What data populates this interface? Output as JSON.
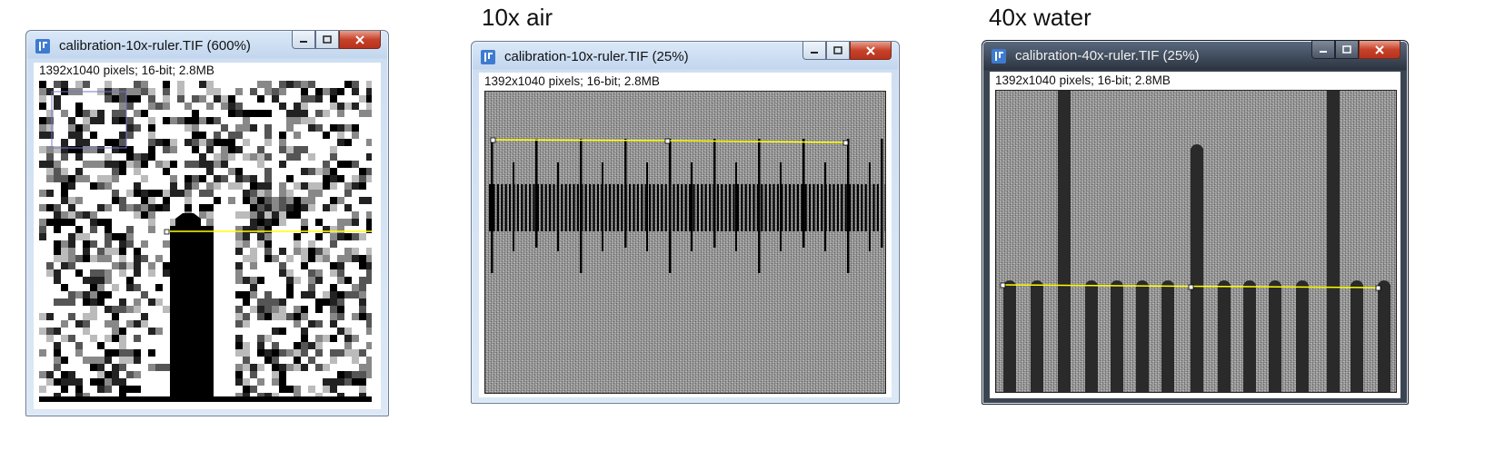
{
  "captions": {
    "air": "10x air",
    "water": "40x water"
  },
  "windows": [
    {
      "title": "calibration-10x-ruler.TIF (600%)",
      "info": "1392x1040 pixels; 16-bit; 2.8MB"
    },
    {
      "title": "calibration-10x-ruler.TIF (25%)",
      "info": "1392x1040 pixels; 16-bit; 2.8MB"
    },
    {
      "title": "calibration-40x-ruler.TIF (25%)",
      "info": "1392x1040 pixels; 16-bit; 2.8MB"
    }
  ],
  "icons": {
    "app": "imagej-icon",
    "minimize": "minimize-icon",
    "maximize": "maximize-icon",
    "close": "close-icon"
  },
  "colors": {
    "line_selection": "#ffff00",
    "title_active": "#c2d6ee",
    "title_dark": "#2c3440",
    "close_button": "#c7422a"
  }
}
